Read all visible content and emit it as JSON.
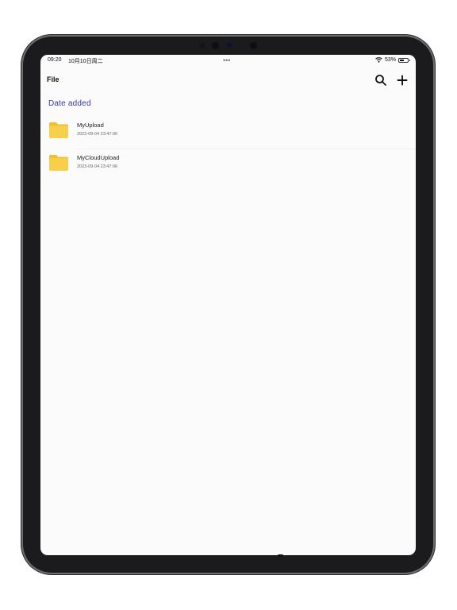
{
  "status_bar": {
    "time": "09:20",
    "date": "10月10日周二",
    "battery": "53%",
    "battery_level": 0.53
  },
  "nav": {
    "title": "File",
    "icons": [
      "search-icon",
      "plus-icon"
    ]
  },
  "section": {
    "title": "Date added"
  },
  "files": [
    {
      "name": "MyUpload",
      "date": "2023-09-04 23:47:06",
      "icon": "folder-icon"
    },
    {
      "name": "MyCloudUpload",
      "date": "2023-09-04 23:47:06",
      "icon": "folder-icon"
    }
  ],
  "colors": {
    "accent": "#2f39b3",
    "folder": "#f8cf4a",
    "folder_tab": "#f0bf32"
  }
}
